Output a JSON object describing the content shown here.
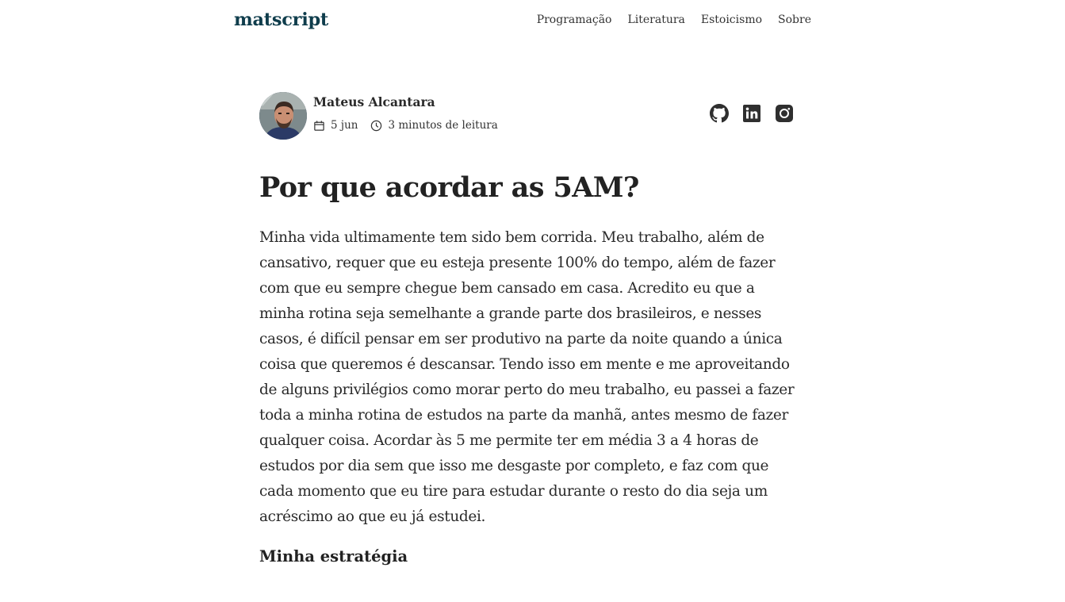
{
  "site": {
    "brand": "matscript",
    "nav": [
      {
        "label": "Programação",
        "name": "nav-programacao"
      },
      {
        "label": "Literatura",
        "name": "nav-literatura"
      },
      {
        "label": "Estoicismo",
        "name": "nav-estoicismo"
      },
      {
        "label": "Sobre",
        "name": "nav-sobre"
      }
    ]
  },
  "author": {
    "name": "Mateus Alcantara",
    "date": "5 jun",
    "reading_time": "3 minutos de leitura",
    "avatar_icon": "avatar-photo",
    "social": [
      {
        "icon": "github-icon"
      },
      {
        "icon": "linkedin-icon"
      },
      {
        "icon": "instagram-icon"
      }
    ]
  },
  "article": {
    "title": "Por que acordar as 5AM?",
    "paragraph": "Minha vida ultimamente tem sido bem corrida. Meu trabalho, além de cansativo, requer que eu esteja presente 100% do tempo, além de fazer com que eu sempre chegue bem cansado em casa. Acredito eu que a minha rotina seja semelhante a grande parte dos brasileiros, e nesses casos, é difícil pensar em ser produtivo na parte da noite quando a única coisa que queremos é descansar. Tendo isso em mente e me aproveitando de alguns privilégios como morar perto do meu trabalho, eu passei a fazer toda a minha rotina de estudos na parte da manhã, antes mesmo de fazer qualquer coisa. Acordar às 5 me permite ter em média 3 a 4 horas de estudos por dia sem que isso me desgaste por completo, e faz com que cada momento que eu tire para estudar durante o resto do dia seja um acréscimo ao que eu já estudei.",
    "subheading": "Minha estratégia"
  },
  "colors": {
    "brand": "#0f3d4c",
    "text": "#2a2a2a",
    "icon": "#2f2f2f"
  }
}
